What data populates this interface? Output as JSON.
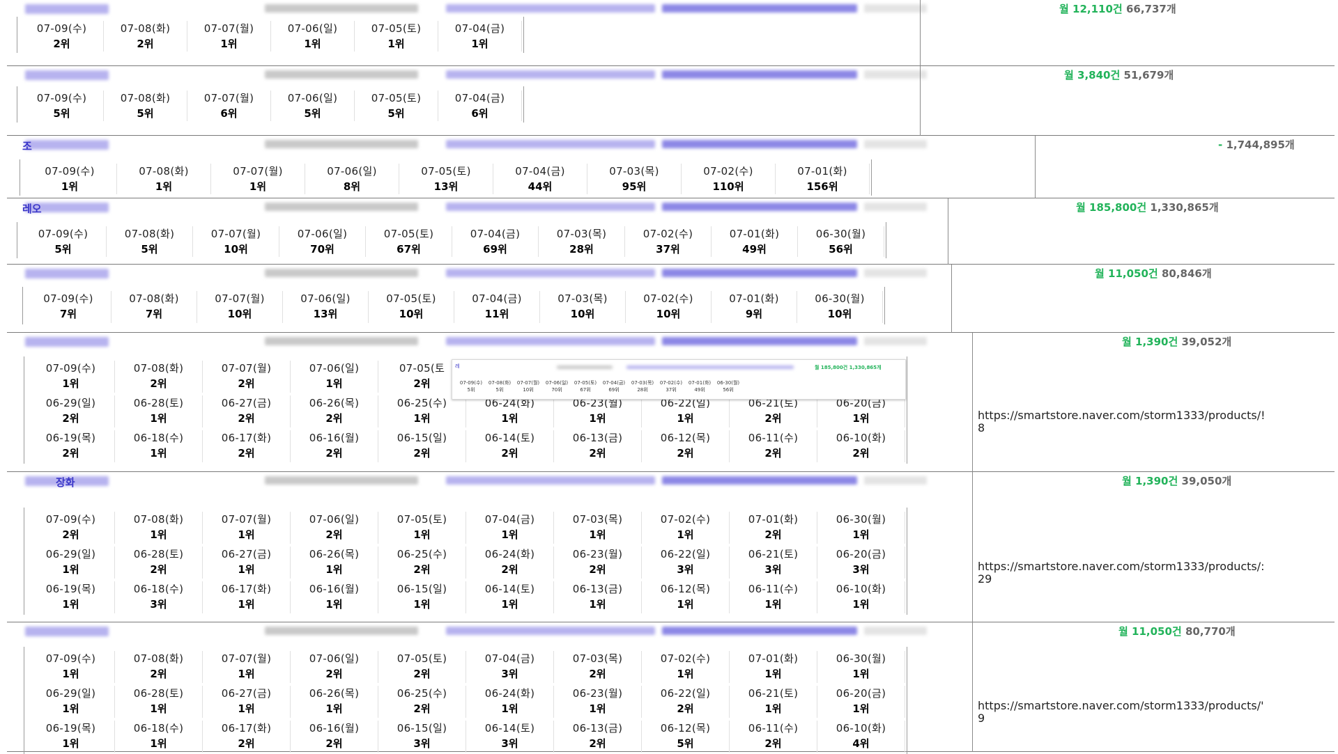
{
  "sections": [
    {
      "name_label": "",
      "stats": {
        "monthly": "월 12,110건",
        "count": "66,737개"
      },
      "rows": [
        [
          {
            "date": "07-09(수)",
            "rank": "2위"
          },
          {
            "date": "07-08(화)",
            "rank": "2위"
          },
          {
            "date": "07-07(월)",
            "rank": "1위"
          },
          {
            "date": "07-06(일)",
            "rank": "1위"
          },
          {
            "date": "07-05(토)",
            "rank": "1위"
          },
          {
            "date": "07-04(금)",
            "rank": "1위"
          }
        ]
      ]
    },
    {
      "name_label": "",
      "stats": {
        "monthly": "월 3,840건",
        "count": "51,679개"
      },
      "rows": [
        [
          {
            "date": "07-09(수)",
            "rank": "5위"
          },
          {
            "date": "07-08(화)",
            "rank": "5위"
          },
          {
            "date": "07-07(월)",
            "rank": "6위"
          },
          {
            "date": "07-06(일)",
            "rank": "5위"
          },
          {
            "date": "07-05(토)",
            "rank": "5위"
          },
          {
            "date": "07-04(금)",
            "rank": "6위"
          }
        ]
      ]
    },
    {
      "name_label": "조",
      "stats": {
        "monthly": "-",
        "count": "1,744,895개"
      },
      "rows": [
        [
          {
            "date": "07-09(수)",
            "rank": "1위"
          },
          {
            "date": "07-08(화)",
            "rank": "1위"
          },
          {
            "date": "07-07(월)",
            "rank": "1위"
          },
          {
            "date": "07-06(일)",
            "rank": "8위"
          },
          {
            "date": "07-05(토)",
            "rank": "13위"
          },
          {
            "date": "07-04(금)",
            "rank": "44위"
          },
          {
            "date": "07-03(목)",
            "rank": "95위"
          },
          {
            "date": "07-02(수)",
            "rank": "110위"
          },
          {
            "date": "07-01(화)",
            "rank": "156위"
          }
        ]
      ]
    },
    {
      "name_label": "레오",
      "stats": {
        "monthly": "월 185,800건",
        "count": "1,330,865개"
      },
      "rows": [
        [
          {
            "date": "07-09(수)",
            "rank": "5위"
          },
          {
            "date": "07-08(화)",
            "rank": "5위"
          },
          {
            "date": "07-07(월)",
            "rank": "10위"
          },
          {
            "date": "07-06(일)",
            "rank": "70위"
          },
          {
            "date": "07-05(토)",
            "rank": "67위"
          },
          {
            "date": "07-04(금)",
            "rank": "69위"
          },
          {
            "date": "07-03(목)",
            "rank": "28위"
          },
          {
            "date": "07-02(수)",
            "rank": "37위"
          },
          {
            "date": "07-01(화)",
            "rank": "49위"
          },
          {
            "date": "06-30(월)",
            "rank": "56위"
          }
        ]
      ]
    },
    {
      "name_label": "",
      "stats": {
        "monthly": "월 11,050건",
        "count": "80,846개"
      },
      "rows": [
        [
          {
            "date": "07-09(수)",
            "rank": "7위"
          },
          {
            "date": "07-08(화)",
            "rank": "7위"
          },
          {
            "date": "07-07(월)",
            "rank": "10위"
          },
          {
            "date": "07-06(일)",
            "rank": "13위"
          },
          {
            "date": "07-05(토)",
            "rank": "10위"
          },
          {
            "date": "07-04(금)",
            "rank": "11위"
          },
          {
            "date": "07-03(목)",
            "rank": "10위"
          },
          {
            "date": "07-02(수)",
            "rank": "10위"
          },
          {
            "date": "07-01(화)",
            "rank": "9위"
          },
          {
            "date": "06-30(월)",
            "rank": "10위"
          }
        ]
      ]
    },
    {
      "name_label": "",
      "stats": {
        "monthly": "월 1,390건",
        "count": "39,052개"
      },
      "url": "https://smartstore.naver.com/storm1333/products/!\n8",
      "rows": [
        [
          {
            "date": "07-09(수)",
            "rank": "1위"
          },
          {
            "date": "07-08(화)",
            "rank": "2위"
          },
          {
            "date": "07-07(월)",
            "rank": "2위"
          },
          {
            "date": "07-06(일)",
            "rank": "1위"
          },
          {
            "date": "07-05(토",
            "rank": "2위"
          }
        ],
        [
          {
            "date": "06-29(일)",
            "rank": "2위"
          },
          {
            "date": "06-28(토)",
            "rank": "1위"
          },
          {
            "date": "06-27(금)",
            "rank": "2위"
          },
          {
            "date": "06-26(목)",
            "rank": "2위"
          },
          {
            "date": "06-25(수)",
            "rank": "1위"
          },
          {
            "date": "06-24(화)",
            "rank": "1위"
          },
          {
            "date": "06-23(월)",
            "rank": "1위"
          },
          {
            "date": "06-22(일)",
            "rank": "1위"
          },
          {
            "date": "06-21(토)",
            "rank": "2위"
          },
          {
            "date": "06-20(금)",
            "rank": "1위"
          }
        ],
        [
          {
            "date": "06-19(목)",
            "rank": "2위"
          },
          {
            "date": "06-18(수)",
            "rank": "1위"
          },
          {
            "date": "06-17(화)",
            "rank": "2위"
          },
          {
            "date": "06-16(월)",
            "rank": "2위"
          },
          {
            "date": "06-15(일)",
            "rank": "2위"
          },
          {
            "date": "06-14(토)",
            "rank": "2위"
          },
          {
            "date": "06-13(금)",
            "rank": "2위"
          },
          {
            "date": "06-12(목)",
            "rank": "2위"
          },
          {
            "date": "06-11(수)",
            "rank": "2위"
          },
          {
            "date": "06-10(화)",
            "rank": "2위"
          }
        ]
      ]
    },
    {
      "name_label": "장화",
      "stats": {
        "monthly": "월 1,390건",
        "count": "39,050개"
      },
      "url": "https://smartstore.naver.com/storm1333/products/:\n29",
      "rows": [
        [
          {
            "date": "07-09(수)",
            "rank": "2위"
          },
          {
            "date": "07-08(화)",
            "rank": "1위"
          },
          {
            "date": "07-07(월)",
            "rank": "1위"
          },
          {
            "date": "07-06(일)",
            "rank": "2위"
          },
          {
            "date": "07-05(토)",
            "rank": "1위"
          },
          {
            "date": "07-04(금)",
            "rank": "1위"
          },
          {
            "date": "07-03(목)",
            "rank": "1위"
          },
          {
            "date": "07-02(수)",
            "rank": "1위"
          },
          {
            "date": "07-01(화)",
            "rank": "2위"
          },
          {
            "date": "06-30(월)",
            "rank": "1위"
          }
        ],
        [
          {
            "date": "06-29(일)",
            "rank": "1위"
          },
          {
            "date": "06-28(토)",
            "rank": "2위"
          },
          {
            "date": "06-27(금)",
            "rank": "1위"
          },
          {
            "date": "06-26(목)",
            "rank": "1위"
          },
          {
            "date": "06-25(수)",
            "rank": "2위"
          },
          {
            "date": "06-24(화)",
            "rank": "2위"
          },
          {
            "date": "06-23(월)",
            "rank": "2위"
          },
          {
            "date": "06-22(일)",
            "rank": "3위"
          },
          {
            "date": "06-21(토)",
            "rank": "3위"
          },
          {
            "date": "06-20(금)",
            "rank": "3위"
          }
        ],
        [
          {
            "date": "06-19(목)",
            "rank": "1위"
          },
          {
            "date": "06-18(수)",
            "rank": "3위"
          },
          {
            "date": "06-17(화)",
            "rank": "1위"
          },
          {
            "date": "06-16(월)",
            "rank": "1위"
          },
          {
            "date": "06-15(일)",
            "rank": "1위"
          },
          {
            "date": "06-14(토)",
            "rank": "1위"
          },
          {
            "date": "06-13(금)",
            "rank": "1위"
          },
          {
            "date": "06-12(목)",
            "rank": "1위"
          },
          {
            "date": "06-11(수)",
            "rank": "1위"
          },
          {
            "date": "06-10(화)",
            "rank": "1위"
          }
        ]
      ]
    },
    {
      "name_label": "",
      "stats": {
        "monthly": "월 11,050건",
        "count": "80,770개"
      },
      "url": "https://smartstore.naver.com/storm1333/products/'\n9",
      "rows": [
        [
          {
            "date": "07-09(수)",
            "rank": "1위"
          },
          {
            "date": "07-08(화)",
            "rank": "2위"
          },
          {
            "date": "07-07(월)",
            "rank": "1위"
          },
          {
            "date": "07-06(일)",
            "rank": "2위"
          },
          {
            "date": "07-05(토)",
            "rank": "2위"
          },
          {
            "date": "07-04(금)",
            "rank": "3위"
          },
          {
            "date": "07-03(목)",
            "rank": "2위"
          },
          {
            "date": "07-02(수)",
            "rank": "1위"
          },
          {
            "date": "07-01(화)",
            "rank": "1위"
          },
          {
            "date": "06-30(월)",
            "rank": "1위"
          }
        ],
        [
          {
            "date": "06-29(일)",
            "rank": "1위"
          },
          {
            "date": "06-28(토)",
            "rank": "1위"
          },
          {
            "date": "06-27(금)",
            "rank": "1위"
          },
          {
            "date": "06-26(목)",
            "rank": "1위"
          },
          {
            "date": "06-25(수)",
            "rank": "2위"
          },
          {
            "date": "06-24(화)",
            "rank": "1위"
          },
          {
            "date": "06-23(월)",
            "rank": "1위"
          },
          {
            "date": "06-22(일)",
            "rank": "2위"
          },
          {
            "date": "06-21(토)",
            "rank": "1위"
          },
          {
            "date": "06-20(금)",
            "rank": "1위"
          }
        ],
        [
          {
            "date": "06-19(목)",
            "rank": "1위"
          },
          {
            "date": "06-18(수)",
            "rank": "1위"
          },
          {
            "date": "06-17(화)",
            "rank": "2위"
          },
          {
            "date": "06-16(월)",
            "rank": "2위"
          },
          {
            "date": "06-15(일)",
            "rank": "3위"
          },
          {
            "date": "06-14(토)",
            "rank": "3위"
          },
          {
            "date": "06-13(금)",
            "rank": "2위"
          },
          {
            "date": "06-12(목)",
            "rank": "5위"
          },
          {
            "date": "06-11(수)",
            "rank": "2위"
          },
          {
            "date": "06-10(화)",
            "rank": "4위"
          }
        ]
      ]
    }
  ],
  "popup": {
    "name_label": "레",
    "stats": "월 185,800건 1,330,865개",
    "cells": [
      {
        "date": "07-09(수)",
        "rank": "5위"
      },
      {
        "date": "07-08(화)",
        "rank": "5위"
      },
      {
        "date": "07-07(월)",
        "rank": "10위"
      },
      {
        "date": "07-06(일)",
        "rank": "70위"
      },
      {
        "date": "07-05(토)",
        "rank": "67위"
      },
      {
        "date": "07-04(금)",
        "rank": "69위"
      },
      {
        "date": "07-03(목)",
        "rank": "28위"
      },
      {
        "date": "07-02(수)",
        "rank": "37위"
      },
      {
        "date": "07-01(화)",
        "rank": "49위"
      },
      {
        "date": "06-30(월)",
        "rank": "56위"
      }
    ]
  }
}
